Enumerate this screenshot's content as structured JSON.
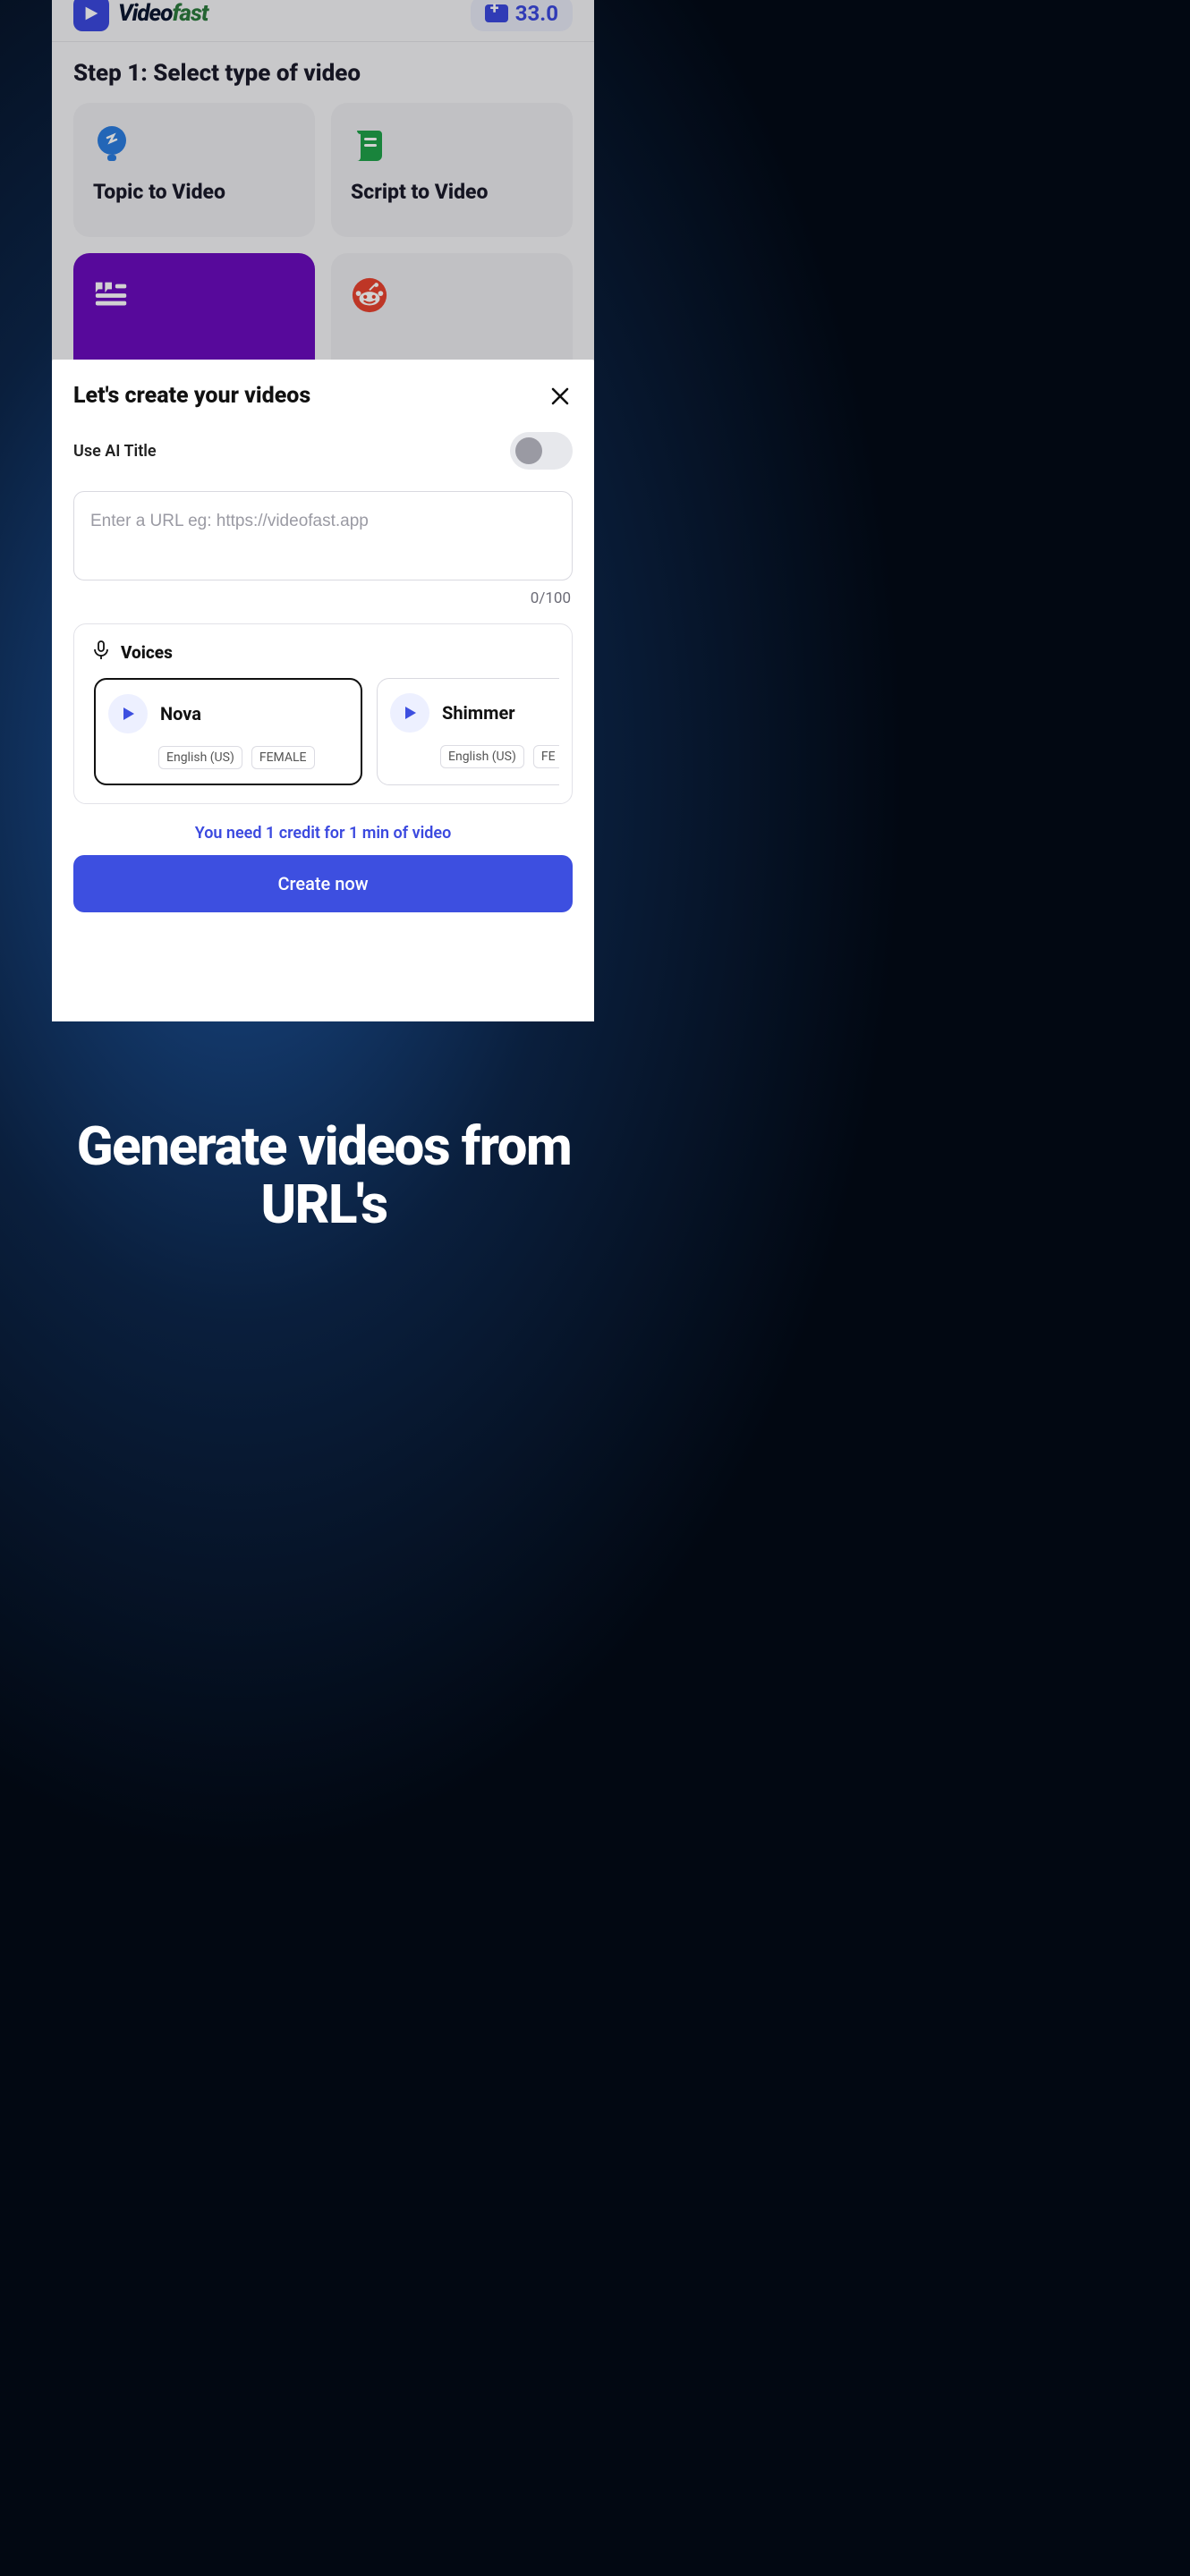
{
  "brand": {
    "name1": "Video",
    "name2": "fast"
  },
  "credits": "33.0",
  "step": {
    "title": "Step 1: Select type of video",
    "cards": [
      {
        "label": "Topic to Video"
      },
      {
        "label": "Script to Video"
      },
      {
        "label": ""
      },
      {
        "label": ""
      }
    ]
  },
  "modal": {
    "title": "Let's create your videos",
    "ai_title_label": "Use AI Title",
    "url_placeholder": "Enter a URL eg: https://videofast.app",
    "counter": "0/100",
    "voices_label": "Voices",
    "voices": [
      {
        "name": "Nova",
        "lang": "English (US)",
        "gender": "FEMALE"
      },
      {
        "name": "Shimmer",
        "lang": "English (US)",
        "gender": "FE"
      }
    ],
    "credit_note": "You need 1 credit for 1 min of video",
    "create_label": "Create now"
  },
  "hero": "Generate videos from URL's"
}
